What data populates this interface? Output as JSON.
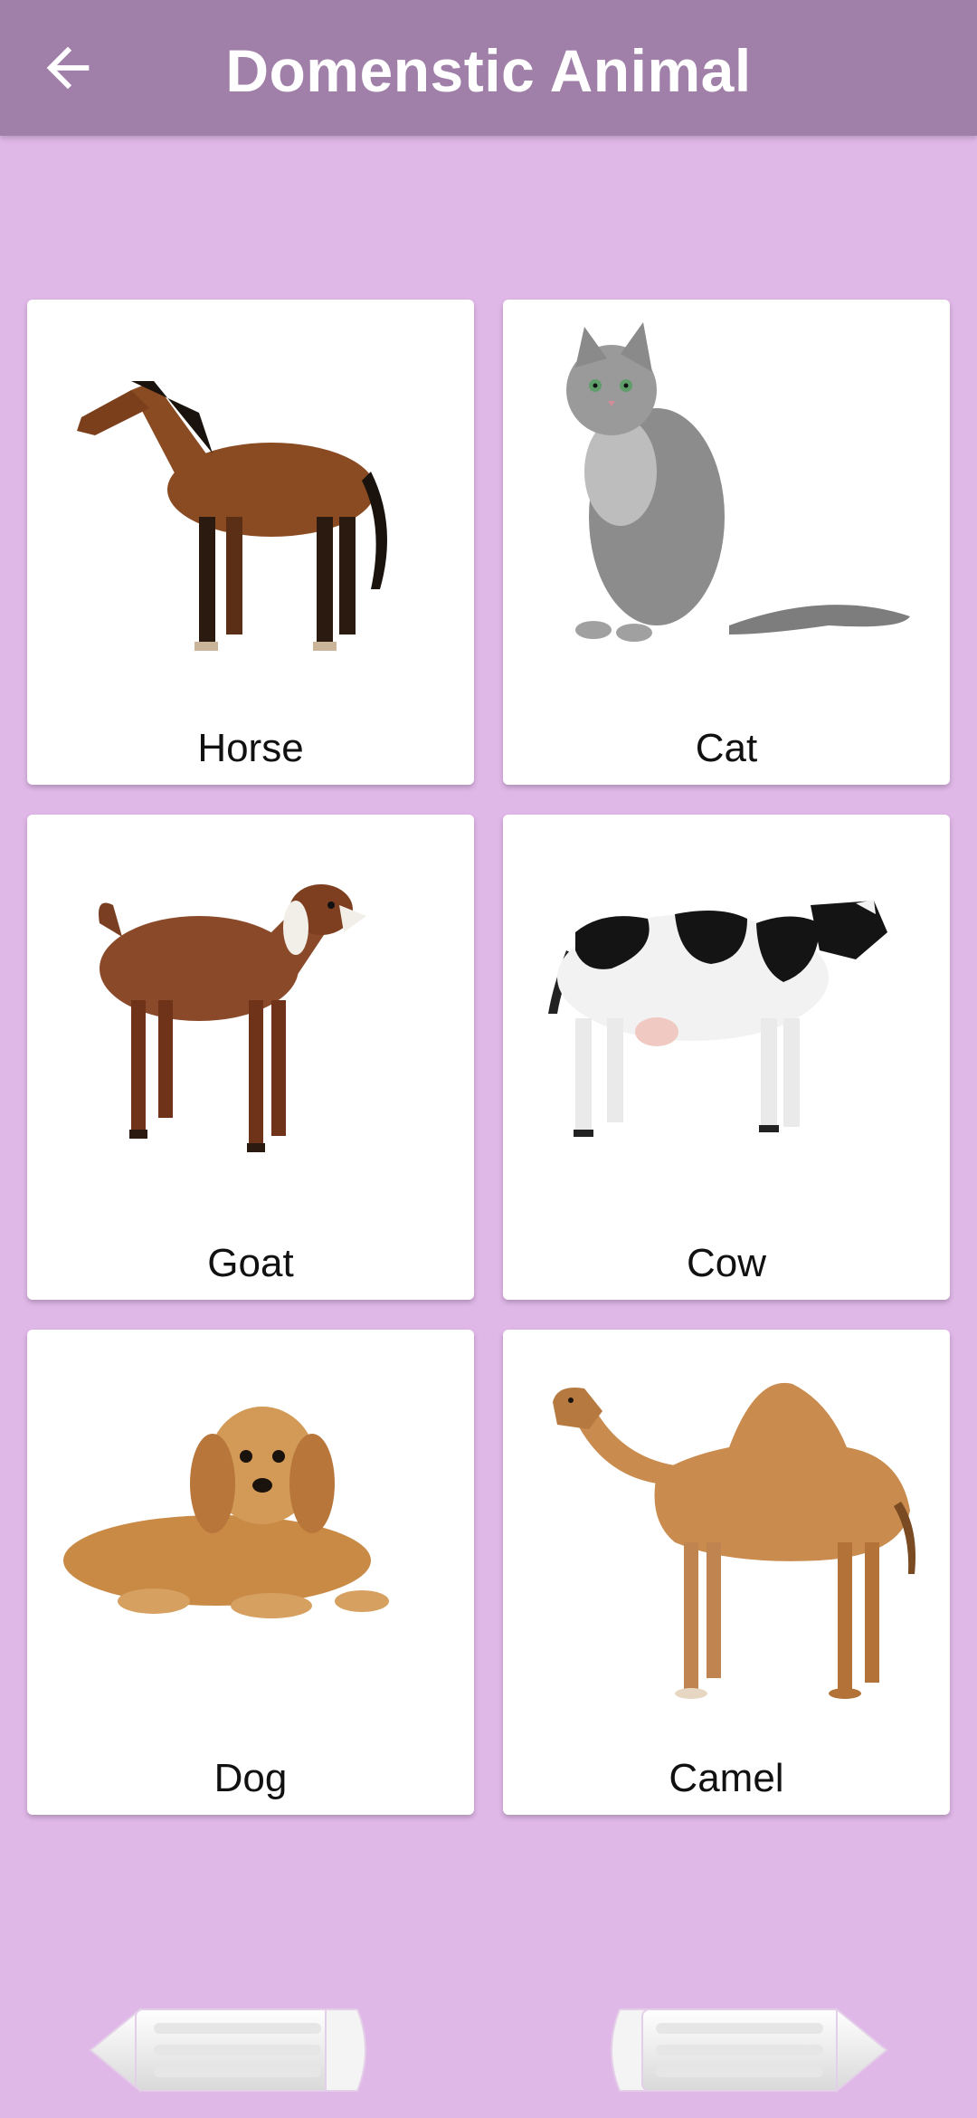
{
  "header": {
    "title": "Domenstic Animal",
    "back_icon": "arrow-left-icon"
  },
  "cards": [
    {
      "label": "Horse"
    },
    {
      "label": "Cat"
    },
    {
      "label": "Goat"
    },
    {
      "label": "Cow"
    },
    {
      "label": "Dog"
    },
    {
      "label": "Camel"
    }
  ],
  "footer": {
    "prev_icon": "pencil-arrow-left-icon",
    "next_icon": "pencil-arrow-right-icon"
  },
  "colors": {
    "background": "#e0b8e8",
    "toolbar": "#a07fa8",
    "card": "#ffffff"
  }
}
